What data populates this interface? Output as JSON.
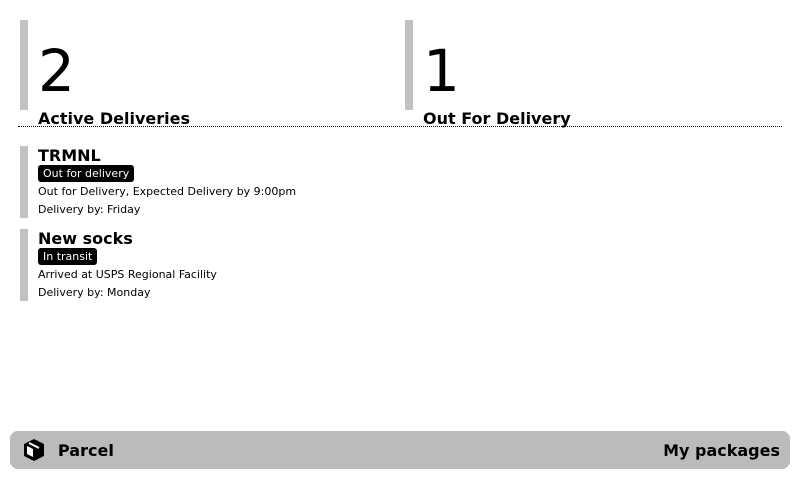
{
  "summary": {
    "active": {
      "count": "2",
      "label": "Active Deliveries"
    },
    "out_for_delivery": {
      "count": "1",
      "label": "Out For Delivery"
    }
  },
  "packages": [
    {
      "title": "TRMNL",
      "status": "Out for delivery",
      "detail": "Out for Delivery, Expected Delivery by 9:00pm",
      "delivery": "Delivery by: Friday"
    },
    {
      "title": "New socks",
      "status": "In transit",
      "detail": "Arrived at USPS Regional Facility",
      "delivery": "Delivery by: Monday"
    }
  ],
  "footer": {
    "app_name": "Parcel",
    "instance_label": "My packages",
    "icon": "package-icon"
  }
}
